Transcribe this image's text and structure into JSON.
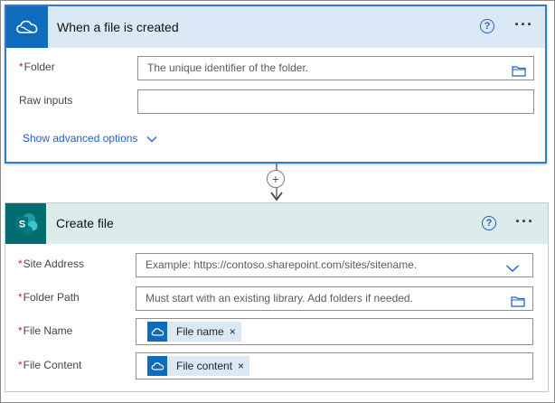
{
  "trigger": {
    "title": "When a file is created",
    "help_glyph": "?",
    "more_glyph": "···",
    "folder_label": "Folder",
    "folder_placeholder": "The unique identifier of the folder.",
    "raw_inputs_label": "Raw inputs",
    "raw_inputs_value": "",
    "advanced_label": "Show advanced options"
  },
  "connector": {
    "add_glyph": "+"
  },
  "action": {
    "title": "Create file",
    "icon_letter": "S",
    "help_glyph": "?",
    "more_glyph": "···",
    "site_address_label": "Site Address",
    "site_address_placeholder": "Example: https://contoso.sharepoint.com/sites/sitename.",
    "folder_path_label": "Folder Path",
    "folder_path_placeholder": "Must start with an existing library. Add folders if needed.",
    "file_name_label": "File Name",
    "file_name_token": "File name",
    "file_content_label": "File Content",
    "file_content_token": "File content",
    "token_remove_glyph": "×"
  },
  "required_marker": "*",
  "colors": {
    "onedrive_blue": "#0f6cbd",
    "sharepoint_teal": "#036c70",
    "trigger_header": "#dbe9f7",
    "action_header": "#dcecea",
    "link_blue": "#2160c4",
    "required_red": "#c42b1c"
  },
  "icons": {
    "trigger_connector": "onedrive-cloud-icon",
    "action_connector": "sharepoint-icon",
    "folder_picker": "folder-icon",
    "dropdown": "chevron-down-icon",
    "token": "onedrive-cloud-icon"
  }
}
